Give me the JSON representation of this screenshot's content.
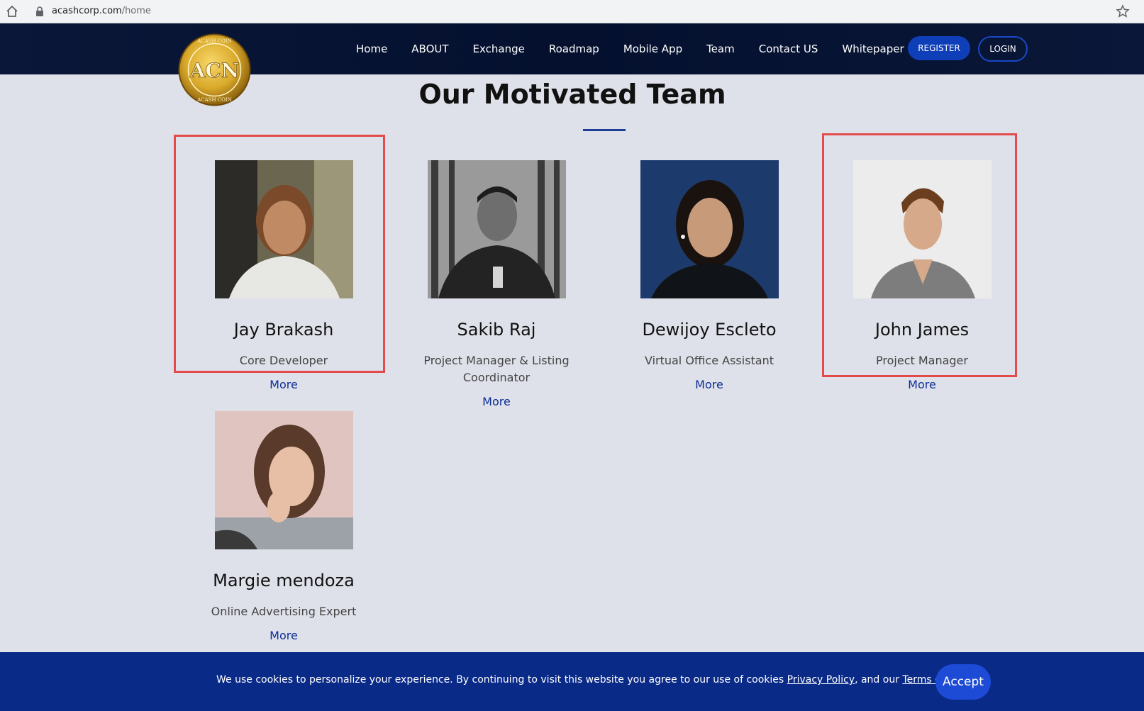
{
  "browser": {
    "url_domain": "acashcorp.com",
    "url_path": "/home"
  },
  "nav": {
    "links": [
      "Home",
      "ABOUT",
      "Exchange",
      "Roadmap",
      "Mobile App",
      "Team",
      "Contact US",
      "Whitepaper"
    ],
    "register_label": "REGISTER",
    "login_label": "LOGIN"
  },
  "logo": {
    "text_top": "ACASH COIN",
    "text_center": "ACN",
    "text_bottom": "ACASH COIN"
  },
  "team": {
    "title": "Our Motivated Team",
    "members": [
      {
        "name": "Jay Brakash",
        "role": "Core Developer",
        "more": "More",
        "highlighted": true
      },
      {
        "name": "Sakib Raj",
        "role": "Project Manager & Listing Coordinator",
        "more": "More",
        "highlighted": false
      },
      {
        "name": "Dewijoy Escleto",
        "role": "Virtual Office Assistant",
        "more": "More",
        "highlighted": false
      },
      {
        "name": "John James",
        "role": "Project Manager",
        "more": "More",
        "highlighted": true
      },
      {
        "name": "Margie mendoza",
        "role": "Online Advertising Expert",
        "more": "More",
        "highlighted": false
      }
    ]
  },
  "cookie": {
    "text_before": "We use cookies to personalize your experience. By continuing to visit this website you agree to our use of cookies ",
    "privacy_link": "Privacy Policy",
    "text_middle": ", and our ",
    "terms_link": "Terms of Service",
    "text_end": ".",
    "accept_label": "Accept"
  },
  "colors": {
    "nav_bg": "#04102e",
    "page_bg": "#dfe1ea",
    "accent_blue": "#0a2a88",
    "highlight_red": "#e34b4b"
  }
}
